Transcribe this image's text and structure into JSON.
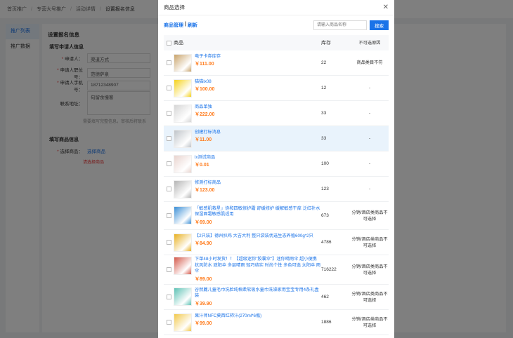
{
  "background": {
    "breadcrumb": [
      "首页推广",
      "专营大号推广",
      "活动详情",
      "设置报名信息"
    ],
    "sidebar": [
      "推广列表",
      "推广数据"
    ],
    "page_title": "设置报名信息",
    "applicant_section": "填写申请人信息",
    "fields": [
      {
        "label": "申请人：",
        "value": "渠道方式",
        "required": true
      },
      {
        "label": "申请人职位号：",
        "value": "范德萨泉",
        "required": true
      },
      {
        "label": "申请人手机号：",
        "value": "18712348907",
        "required": true
      },
      {
        "label": "联系地址：",
        "value": "旬留余撞客",
        "required": false
      }
    ],
    "hint": "需要填写完整信息，审核后将联系",
    "goods_section": "填写商品信息",
    "goods_label": "选择商品：",
    "goods_link": "选择商品",
    "goods_error": "请选择商品"
  },
  "modal": {
    "title": "商品选择",
    "links": {
      "manage": "商品管理",
      "separator": "|",
      "refresh": "刷新"
    },
    "search_placeholder": "请输入商品名称",
    "search_button": "搜索",
    "columns": {
      "product": "商品",
      "stock": "库存",
      "note": "不可选原因"
    },
    "rows": [
      {
        "name": "电子卡券库存",
        "price": "￥111.00",
        "stock": "22",
        "note": "商品类目不符",
        "thumb": "#c9a36a",
        "height": 36,
        "highlight": false
      },
      {
        "name": "猫猫lx08",
        "price": "￥100.00",
        "stock": "12",
        "note": "-",
        "thumb": "#f5d21a",
        "height": 36,
        "highlight": false
      },
      {
        "name": "商品单独",
        "price": "￥222.00",
        "stock": "33",
        "note": "-",
        "thumb": "#d6d6d6",
        "height": 36,
        "highlight": false
      },
      {
        "name": "创建打标消息",
        "price": "￥11.00",
        "stock": "33",
        "note": "-",
        "thumb": "#bfc4c9",
        "height": 36,
        "highlight": true
      },
      {
        "name": "lx测试商品",
        "price": "￥0.01",
        "stock": "100",
        "note": "-",
        "thumb": "#e9d4cf",
        "height": 36,
        "highlight": false
      },
      {
        "name": "修测打标商品",
        "price": "￥123.00",
        "stock": "123",
        "note": "-",
        "thumb": "#b5b5b5",
        "height": 36,
        "highlight": false
      },
      {
        "name": "「敏感肌救星」协和四敏修护霜 舒缓修护 缓解敏感干痒 泛红补水保湿面霜敏感肌适用",
        "price": "￥69.00",
        "stock": "673",
        "note": "分销/酒店类商品不可选择",
        "thumb": "#3b8fd6",
        "height": 40,
        "highlight": false
      },
      {
        "name": "【2只装】德州扒鸡 大吉大利 整只袋装优选生态养殖600g*2只",
        "price": "￥84.90",
        "stock": "4786",
        "note": "分销/酒店类商品不可选择",
        "thumb": "#e8b020",
        "height": 36,
        "highlight": false
      },
      {
        "name": "下单48小时发货！！【超级迷你\"胶囊伞\"】迷你晴雨伞 超小便携 抗风防水 遮阳伞 多层晴雨 轻巧结实 时尚个性 多色可选 太阳伞 雨伞",
        "price": "￥89.00",
        "stock": "716222",
        "note": "分销/酒店类商品不可选择",
        "thumb": "#d4584a",
        "height": 42,
        "highlight": false
      },
      {
        "name": "谷然麗儿童毛巾洗脸纯棉柔软吸水童巾洗澡家用宝宝专用4条礼盒装",
        "price": "￥39.90",
        "stock": "462",
        "note": "分销/酒店类商品不可选择",
        "thumb": "#5ec2b5",
        "height": 36,
        "highlight": false
      },
      {
        "name": "果汁师NFC莫西红柿汁(270ml*6瓶)",
        "price": "￥99.00",
        "stock": "1886",
        "note": "分销/酒店类商品不可选择",
        "thumb": "#f2c94c",
        "height": 36,
        "highlight": false
      }
    ]
  }
}
